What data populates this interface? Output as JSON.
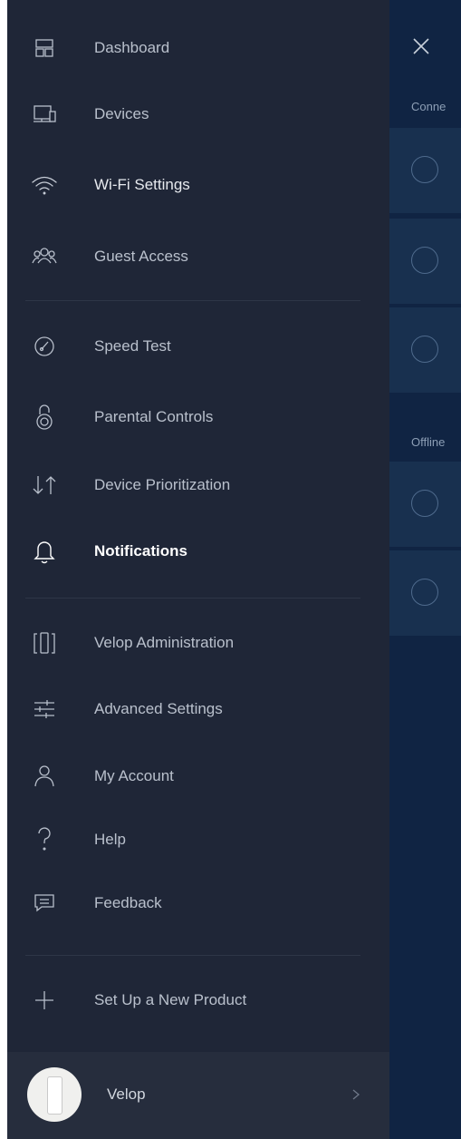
{
  "drawer": {
    "items": [
      {
        "label": "Dashboard",
        "icon": "dashboard-icon"
      },
      {
        "label": "Devices",
        "icon": "devices-icon"
      },
      {
        "label": "Wi-Fi Settings",
        "icon": "wifi-icon"
      },
      {
        "label": "Guest Access",
        "icon": "guest-access-icon"
      },
      {
        "label": "Speed Test",
        "icon": "speedometer-icon"
      },
      {
        "label": "Parental Controls",
        "icon": "parental-controls-icon"
      },
      {
        "label": "Device Prioritization",
        "icon": "prioritization-icon"
      },
      {
        "label": "Notifications",
        "icon": "bell-icon",
        "active": true
      },
      {
        "label": "Velop Administration",
        "icon": "velop-admin-icon"
      },
      {
        "label": "Advanced Settings",
        "icon": "sliders-icon"
      },
      {
        "label": "My Account",
        "icon": "user-icon"
      },
      {
        "label": "Help",
        "icon": "help-icon"
      },
      {
        "label": "Feedback",
        "icon": "feedback-icon"
      },
      {
        "label": "Set Up a New Product",
        "icon": "plus-icon"
      }
    ],
    "footer": {
      "label": "Velop",
      "icon": "velop-node-icon"
    }
  },
  "background": {
    "connected_label": "Conne",
    "offline_label": "Offline"
  },
  "colors": {
    "drawer_bg": "#1f2637",
    "text": "#b9c0cc",
    "active_text": "#ffffff",
    "icon_stroke": "#b8bfcb",
    "background_panel": "#102443"
  }
}
